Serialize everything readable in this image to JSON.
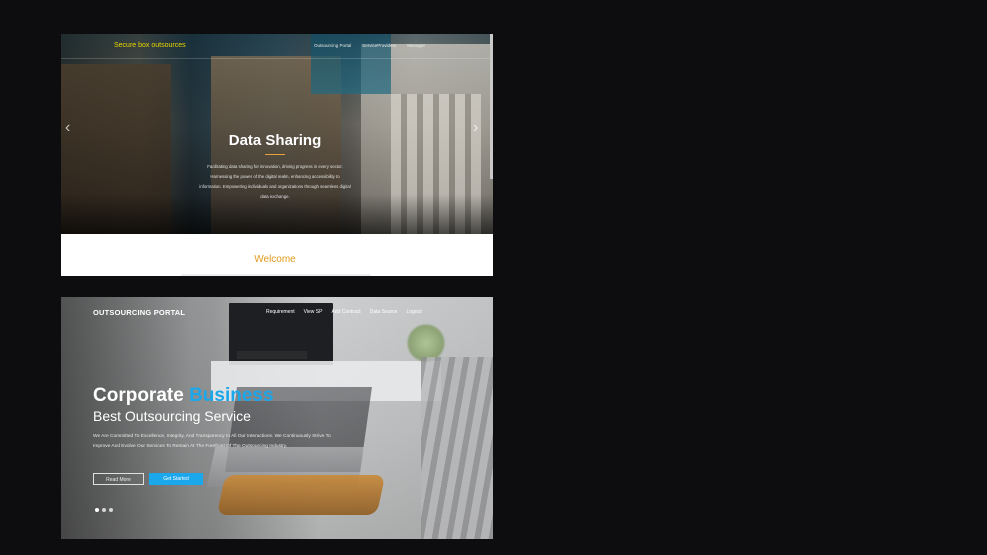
{
  "panel_top": {
    "brand": "Secure box outsources",
    "menu": [
      "Outsourcing Portal",
      "ServiceProviders",
      "Manager"
    ],
    "hero_title": "Data Sharing",
    "hero_description": "Facilitating data sharing for innovation, driving progress in every sector. Harnessing the power of the digital realm, enhancing accessibility to information. Empowering individuals and organizations through seamless digital data exchange.",
    "prev_arrow": "‹",
    "next_arrow": "›",
    "welcome": "Welcome",
    "accent_color": "#e39a1c",
    "brand_color": "#e8d500"
  },
  "panel_bottom": {
    "brand": "OUTSOURCING PORTAL",
    "menu": [
      "Requirement",
      "View SP",
      "Add Contract",
      "Data Source",
      "Logout"
    ],
    "headline_plain": "Corporate ",
    "headline_accent": "Business",
    "subheadline": "Best Outsourcing Service",
    "description": "We Are Committed To Excellence, Integrity, And Transparency In All Our Interactions. We Continuously Strive To Improve And Evolve Our Services To Remain At The Forefront Of The Outsourcing Industry.",
    "read_more": "Read More",
    "get_started": "Get Started",
    "slides": 3,
    "accent_color": "#1aa7ec"
  }
}
